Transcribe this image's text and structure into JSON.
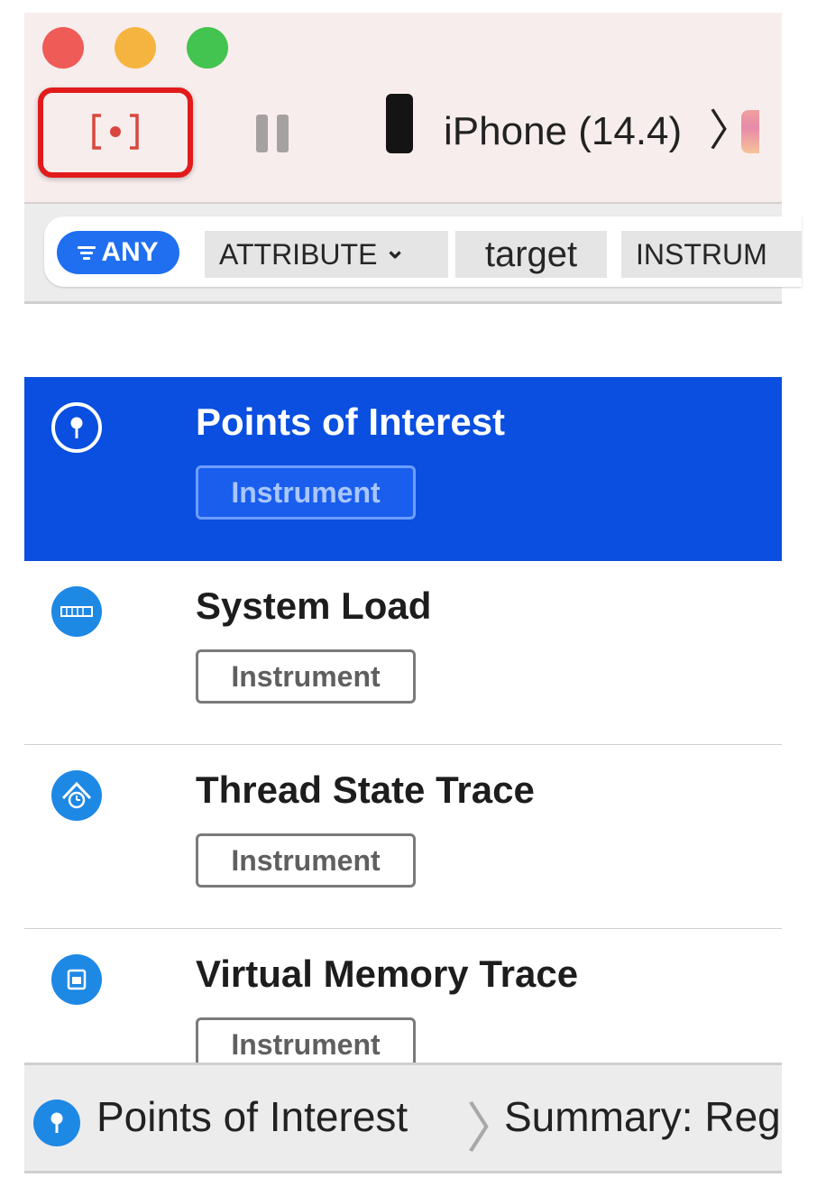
{
  "toolbar": {
    "device_label": "iPhone (14.4)",
    "chevron": "〉",
    "record_glyph": "[•]",
    "icons": [
      "record-icon",
      "pause-icon",
      "phone-icon"
    ]
  },
  "filter": {
    "any_label": "ANY",
    "attribute_label": "ATTRIBUTE",
    "attribute_chevron": "⌄",
    "target_text": "target",
    "instrument_label": "INSTRUM"
  },
  "list": {
    "items": [
      {
        "title": "Points of Interest",
        "badge": "Instrument",
        "icon": "pin-icon",
        "selected": true
      },
      {
        "title": "System Load",
        "badge": "Instrument",
        "icon": "system-load-icon",
        "selected": false
      },
      {
        "title": "Thread State Trace",
        "badge": "Instrument",
        "icon": "thread-state-icon",
        "selected": false
      },
      {
        "title": "Virtual Memory Trace",
        "badge": "Instrument",
        "icon": "virtual-memory-icon",
        "selected": false
      }
    ]
  },
  "navbar": {
    "crumb1": "Points of Interest",
    "separator": "〉",
    "crumb2": "Summary: Reg"
  },
  "colors": {
    "selection": "#0a4fe0",
    "accent": "#1f6ff0",
    "record_highlight": "#e11b1b",
    "close": "#ef5b57",
    "minimize": "#f5b43f",
    "zoom": "#43c34f"
  }
}
